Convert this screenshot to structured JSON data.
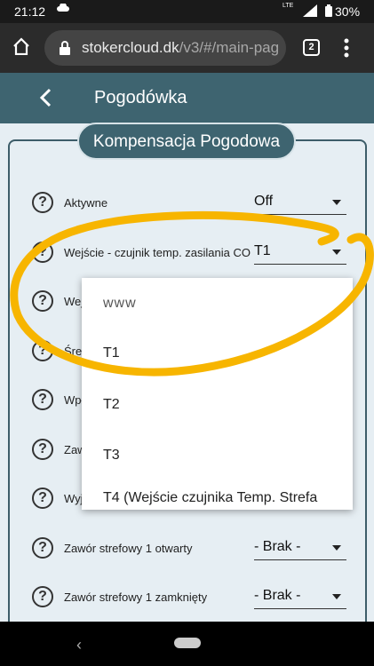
{
  "status_bar": {
    "time": "21:12",
    "network": "LTE",
    "battery": "30%"
  },
  "browser": {
    "url_domain": "stokercloud.dk",
    "url_path": "/v3/#/main-pag",
    "tab_count": "2"
  },
  "app": {
    "title": "Pogodówka"
  },
  "panel": {
    "title": "Kompensacja Pogodowa"
  },
  "rows": [
    {
      "label": "Aktywne",
      "value": "Off"
    },
    {
      "label": "Wejście - czujnik temp. zasilania CO",
      "value": "T1"
    },
    {
      "label": "Wej",
      "value": ""
    },
    {
      "label": "Śred",
      "value": ""
    },
    {
      "label": "Wpł",
      "value": ""
    },
    {
      "label": "Zaw",
      "value": ""
    },
    {
      "label": "Wyj",
      "value": ""
    },
    {
      "label": "Zawór strefowy 1 otwarty",
      "value": "- Brak -"
    },
    {
      "label": "Zawór strefowy 1 zamknięty",
      "value": "- Brak -"
    }
  ],
  "dropdown": {
    "options": [
      "www",
      "T1",
      "T2",
      "T3",
      "T4 (Wejście czujnika Temp. Strefa"
    ]
  },
  "colors": {
    "header": "#3e6470",
    "annotation": "#f7b500",
    "background": "#e6eef3"
  }
}
